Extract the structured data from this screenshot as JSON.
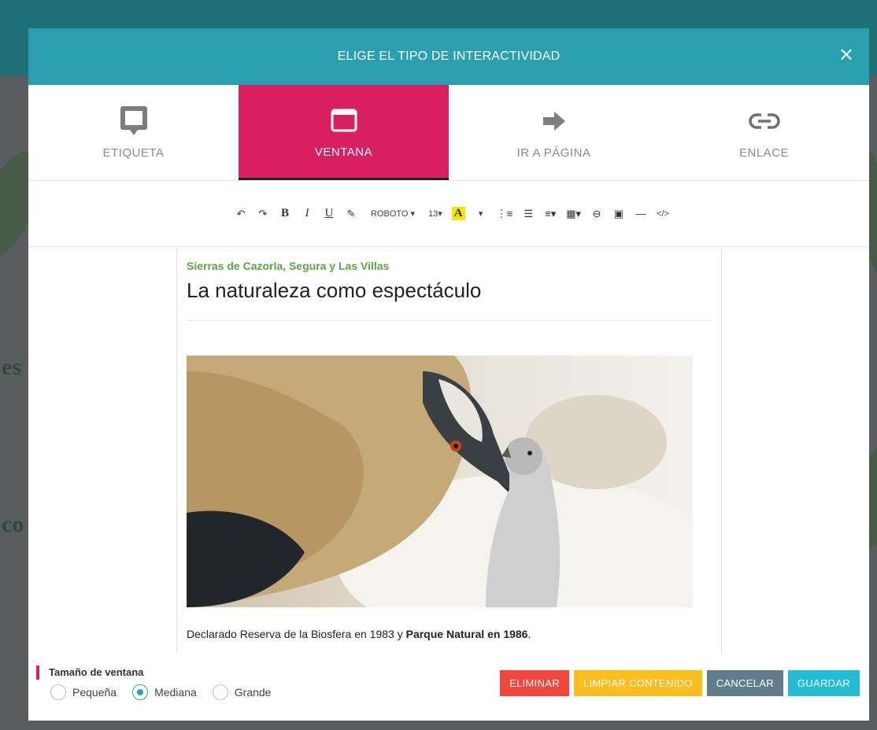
{
  "modal": {
    "title": "ELIGE EL TIPO DE INTERACTIVIDAD",
    "close_glyph": "✕"
  },
  "tabs": [
    {
      "label": "ETIQUETA",
      "icon": "comment-box-icon",
      "active": false
    },
    {
      "label": "VENTANA",
      "icon": "window-icon",
      "active": true
    },
    {
      "label": "IR A PÁGINA",
      "icon": "arrow-right-icon",
      "active": false
    },
    {
      "label": "ENLACE",
      "icon": "link-icon",
      "active": false
    }
  ],
  "toolbar": {
    "undo": "↶",
    "redo": "↷",
    "bold": "B",
    "italic": "I",
    "underline": "U",
    "eraser": "✎",
    "font_select": "ROBOTO ▾",
    "size_select": "13▾",
    "color": "A",
    "color_arrow": "▾",
    "ordered_list": "⋮≡",
    "unordered_list": "☰",
    "align": "≡▾",
    "table": "▦▾",
    "link": "⊖",
    "image": "▣",
    "hr": "—",
    "code": "</>"
  },
  "document": {
    "kicker": "Sierras de Cazorla, Segura y Las Villas",
    "title": "La naturaleza como espectáculo",
    "caption_plain": "Declarado Reserva de la Biosfera en 1983 y ",
    "caption_bold": "Parque Natural en 1986",
    "caption_end": "."
  },
  "footer": {
    "size_label": "Tamaño de ventana",
    "options": [
      {
        "label": "Pequeña",
        "checked": false
      },
      {
        "label": "Mediana",
        "checked": true
      },
      {
        "label": "Grande",
        "checked": false
      }
    ],
    "buttons": {
      "delete": "ELIMINAR",
      "clear": "LIMPIAR CONTENIDO",
      "cancel": "CANCELAR",
      "save": "GUARDAR"
    }
  },
  "background": {
    "fragment_1": "es",
    "fragment_2": "co"
  },
  "colors": {
    "header": "#2a9fb0",
    "active_tab": "#d81f5f",
    "kicker": "#58a83e",
    "delete": "#f0473a",
    "clear": "#fbbd1e",
    "cancel": "#607d8b",
    "save": "#22bcd4",
    "radio": "#22a6b8"
  }
}
